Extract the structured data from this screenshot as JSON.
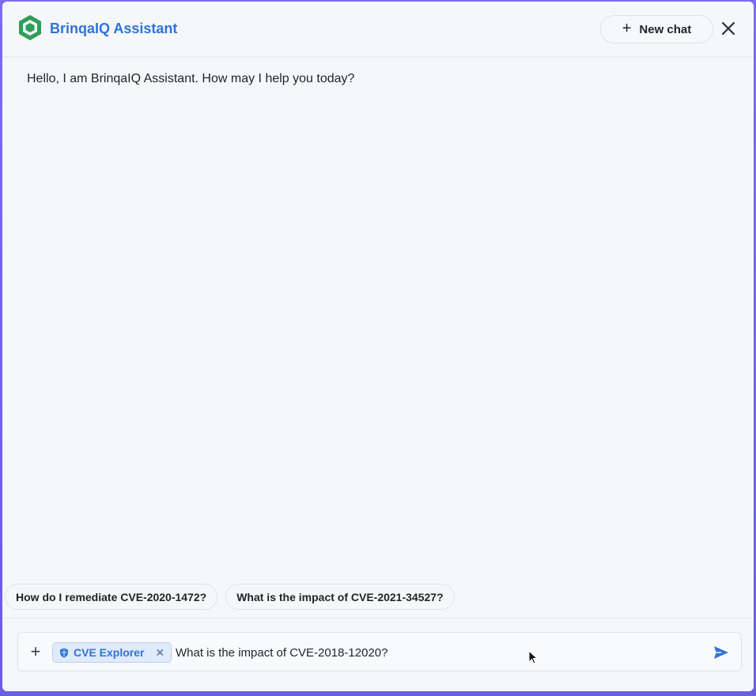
{
  "app": {
    "title": "BrinqaIQ Assistant"
  },
  "header": {
    "new_chat_label": "New chat"
  },
  "conversation": {
    "greeting": "Hello, I am BrinqaIQ Assistant. How may I help you today?"
  },
  "suggestions": [
    "How do I remediate CVE-2020-1472?",
    "What is the impact of CVE-2021-34527?"
  ],
  "composer": {
    "tool_tag": "CVE Explorer",
    "value": "What is the impact of CVE-2018-12020?"
  },
  "colors": {
    "accent": "#2f73d8",
    "logo": "#2e9e57",
    "background": "#f5f7fb"
  }
}
